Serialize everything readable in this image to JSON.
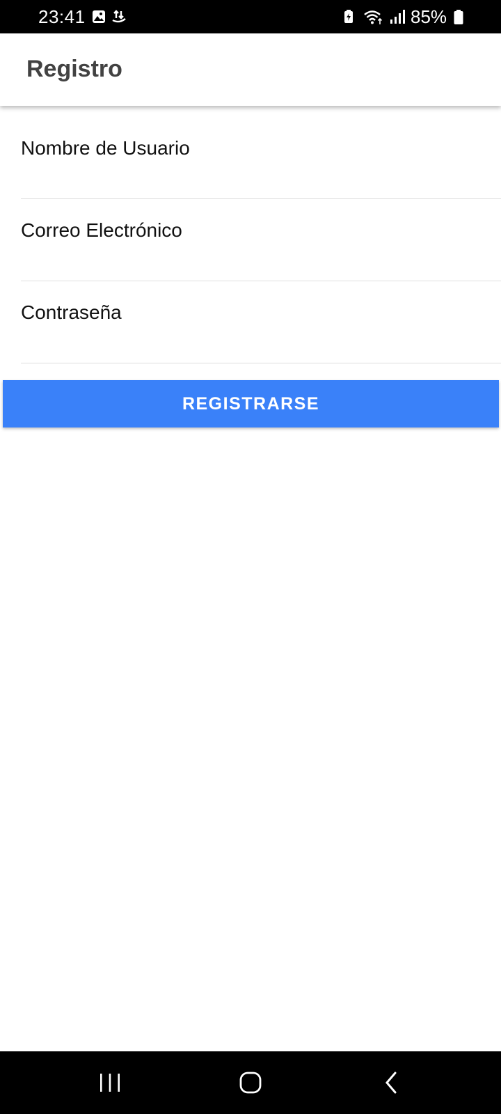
{
  "status_bar": {
    "time": "23:41",
    "battery": "85%",
    "icons": [
      "gallery-icon",
      "data-sync-icon",
      "battery-saver-icon",
      "wifi-icon",
      "signal-icon",
      "battery-icon"
    ]
  },
  "app_bar": {
    "title": "Registro"
  },
  "form": {
    "username": {
      "placeholder": "Nombre de Usuario",
      "value": ""
    },
    "email": {
      "placeholder": "Correo Electrónico",
      "value": ""
    },
    "password": {
      "placeholder": "Contraseña",
      "value": ""
    },
    "submit_label": "REGISTRARSE"
  },
  "nav_bar": {
    "icons": [
      "recent-apps-icon",
      "home-icon",
      "back-icon"
    ]
  },
  "colors": {
    "button": "#3a81f9",
    "status_bar": "#000000",
    "title": "#424242"
  }
}
